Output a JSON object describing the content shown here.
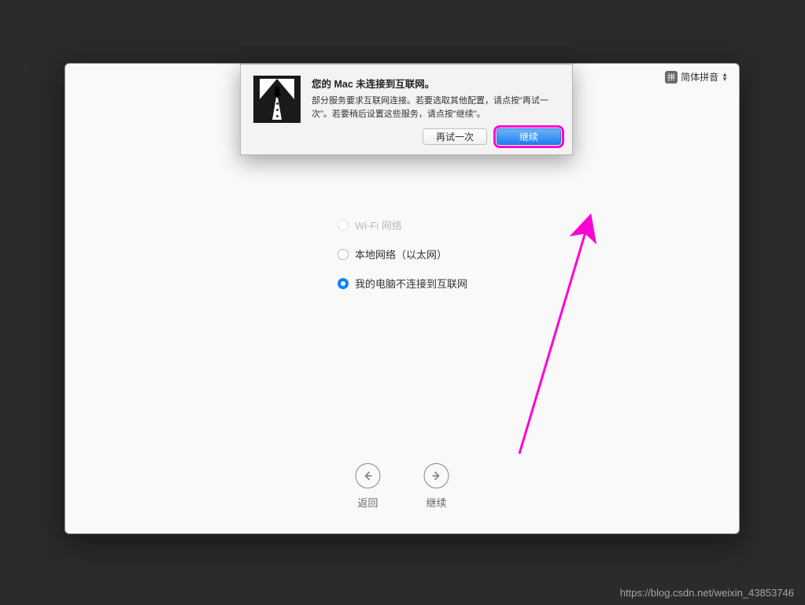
{
  "ime": {
    "badge": "拼",
    "label": "简体拼音"
  },
  "options": {
    "wifi": "Wi-Fi 网络",
    "ethernet": "本地网络（以太网）",
    "nointernet": "我的电脑不连接到互联网"
  },
  "nav": {
    "back": "返回",
    "continue": "继续"
  },
  "dialog": {
    "title": "您的 Mac 未连接到互联网。",
    "message": "部分服务要求互联网连接。若要选取其他配置，请点按\"再试一次\"。若要稍后设置这些服务，请点按\"继续\"。",
    "retry": "再试一次",
    "continue": "继续"
  },
  "watermark": "https://blog.csdn.net/weixin_43853746"
}
